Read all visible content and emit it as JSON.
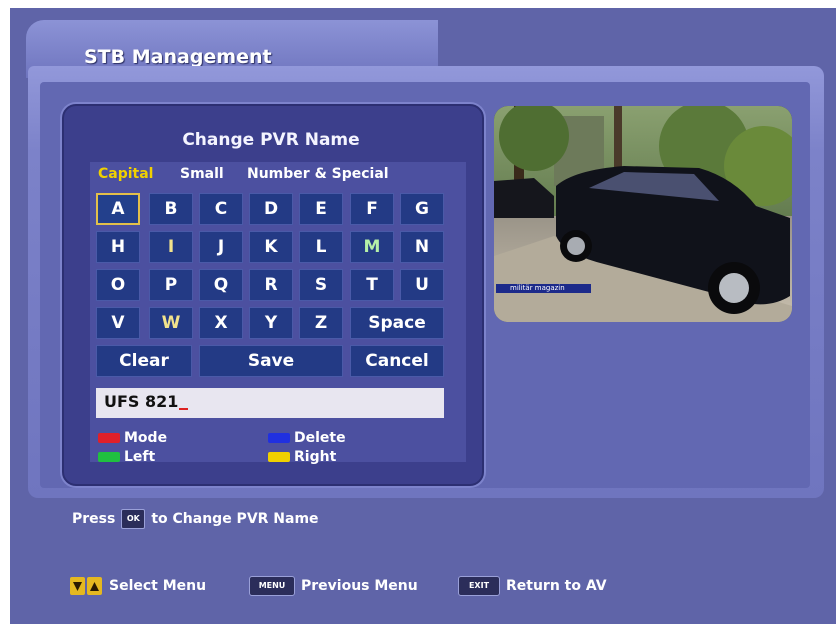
{
  "window": {
    "title": "STB Management"
  },
  "keyboard": {
    "title": "Change PVR Name",
    "modes": {
      "capital": "Capital",
      "small": "Small",
      "number_special": "Number & Special"
    },
    "rows": [
      [
        "A",
        "B",
        "C",
        "D",
        "E",
        "F",
        "G"
      ],
      [
        "H",
        "I",
        "J",
        "K",
        "L",
        "M",
        "N"
      ],
      [
        "O",
        "P",
        "Q",
        "R",
        "S",
        "T",
        "U"
      ],
      [
        "V",
        "W",
        "X",
        "Y",
        "Z"
      ]
    ],
    "space": "Space",
    "clear": "Clear",
    "save": "Save",
    "cancel": "Cancel",
    "selected_key": "A",
    "input_value": "UFS 821"
  },
  "legend": {
    "mode": "Mode",
    "left": "Left",
    "delete": "Delete",
    "right": "Right",
    "colors": {
      "red": "#e0202a",
      "green": "#20c040",
      "blue": "#2030e0",
      "yellow": "#f0d000"
    }
  },
  "preview": {
    "channel_label": "militär magazin"
  },
  "hint": {
    "press": "Press",
    "ok": "OK",
    "action": "to Change PVR Name"
  },
  "bottom": {
    "select": "Select Menu",
    "menu_btn": "MENU",
    "previous": "Previous Menu",
    "exit_btn": "EXIT",
    "return": "Return to AV"
  }
}
